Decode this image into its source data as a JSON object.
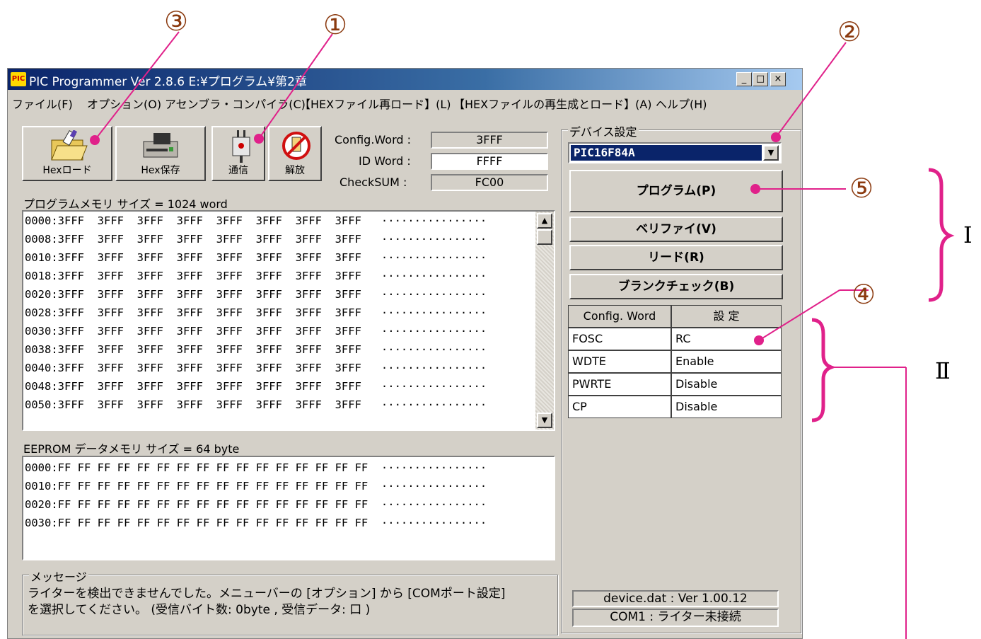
{
  "window": {
    "title": "PIC Programmer Ver 2.8.6  E:¥プログラム¥第2章",
    "icon_text": "PIC",
    "title_buttons": [
      "_",
      "□",
      "×"
    ]
  },
  "menu": [
    "ファイル(F)",
    "オプション(O)",
    "アセンブラ・コンパイラ(C)",
    "【HEXファイル再ロード】(L)",
    "【HEXファイルの再生成とロード】(A)",
    "ヘルプ(H)"
  ],
  "toolbar": {
    "hex_load": "Hexロード",
    "hex_save": "Hex保存",
    "comm": "通信",
    "release": "解放"
  },
  "info": {
    "config_label": "Config.Word :",
    "config_value": "3FFF",
    "id_label": "ID Word :",
    "id_value": "FFFF",
    "checksum_label": "CheckSUM :",
    "checksum_value": "FC00"
  },
  "program_memory": {
    "label": "プログラムメモリ サイズ  = 1024 word",
    "rows": [
      "0000:3FFF  3FFF  3FFF  3FFF  3FFF  3FFF  3FFF  3FFF   ················",
      "0008:3FFF  3FFF  3FFF  3FFF  3FFF  3FFF  3FFF  3FFF   ················",
      "0010:3FFF  3FFF  3FFF  3FFF  3FFF  3FFF  3FFF  3FFF   ················",
      "0018:3FFF  3FFF  3FFF  3FFF  3FFF  3FFF  3FFF  3FFF   ················",
      "0020:3FFF  3FFF  3FFF  3FFF  3FFF  3FFF  3FFF  3FFF   ················",
      "0028:3FFF  3FFF  3FFF  3FFF  3FFF  3FFF  3FFF  3FFF   ················",
      "0030:3FFF  3FFF  3FFF  3FFF  3FFF  3FFF  3FFF  3FFF   ················",
      "0038:3FFF  3FFF  3FFF  3FFF  3FFF  3FFF  3FFF  3FFF   ················",
      "0040:3FFF  3FFF  3FFF  3FFF  3FFF  3FFF  3FFF  3FFF   ················",
      "0048:3FFF  3FFF  3FFF  3FFF  3FFF  3FFF  3FFF  3FFF   ················",
      "0050:3FFF  3FFF  3FFF  3FFF  3FFF  3FFF  3FFF  3FFF   ················"
    ]
  },
  "eeprom": {
    "label": "EEPROM データメモリ サイズ  = 64 byte",
    "rows": [
      "0000:FF FF FF FF FF FF FF FF FF FF FF FF FF FF FF FF  ················",
      "0010:FF FF FF FF FF FF FF FF FF FF FF FF FF FF FF FF  ················",
      "0020:FF FF FF FF FF FF FF FF FF FF FF FF FF FF FF FF  ················",
      "0030:FF FF FF FF FF FF FF FF FF FF FF FF FF FF FF FF  ················"
    ]
  },
  "message": {
    "legend": "メッセージ",
    "line1": "ライターを検出できませんでした。メニューバーの [オプション] から [COMポート設定]",
    "line2": "を選択してください。 (受信バイト数: 0byte , 受信データ: 口 )"
  },
  "device": {
    "legend": "デバイス設定",
    "selected": "PIC16F84A",
    "program_btn": "プログラム(P)",
    "verify_btn": "ベリファイ(V)",
    "read_btn": "リード(R)",
    "blank_btn": "ブランクチェック(B)",
    "grid_headers": [
      "Config. Word",
      "設 定"
    ],
    "grid_rows": [
      {
        "name": "FOSC",
        "value": "RC"
      },
      {
        "name": "WDTE",
        "value": "Enable"
      },
      {
        "name": "PWRTE",
        "value": "Disable"
      },
      {
        "name": "CP",
        "value": "Disable"
      }
    ],
    "status_ver": "device.dat : Ver 1.00.12",
    "status_com": "COM1 : ライター未接続"
  },
  "annotations": {
    "c1": "①",
    "c2": "②",
    "c3": "③",
    "c4": "④",
    "c5": "⑤",
    "roman1": "Ⅰ",
    "roman2": "Ⅱ",
    "color": "#e0218a"
  }
}
